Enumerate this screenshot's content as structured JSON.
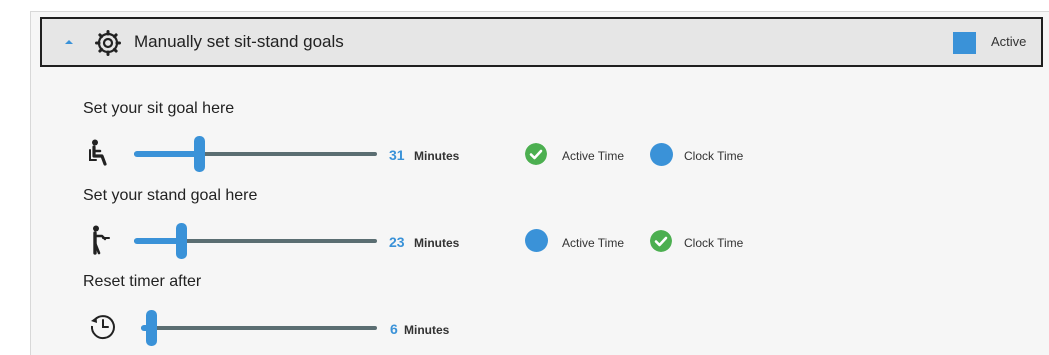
{
  "header": {
    "title": "Manually set sit-stand goals",
    "status_label": "Active",
    "accent_color": "#3a92d8"
  },
  "sit": {
    "title": "Set your sit goal here",
    "icon": "sitting-person-icon",
    "value": "31",
    "unit": "Minutes",
    "slider_level": 0.27,
    "option1": {
      "label": "Active Time",
      "state": "checked"
    },
    "option2": {
      "label": "Clock Time",
      "state": "unchecked"
    }
  },
  "stand": {
    "title": "Set your stand goal here",
    "icon": "standing-person-icon",
    "value": "23",
    "unit": "Minutes",
    "slider_level": 0.2,
    "option1": {
      "label": "Active Time",
      "state": "unchecked"
    },
    "option2": {
      "label": "Clock Time",
      "state": "checked"
    }
  },
  "reset": {
    "title": "Reset timer after",
    "icon": "timer-reset-icon",
    "value": "6",
    "unit": "Minutes",
    "slider_level": 0.04
  },
  "colors": {
    "check_green": "#4caf50",
    "radio_blue": "#3a92d8",
    "track": "#5b6e72"
  }
}
